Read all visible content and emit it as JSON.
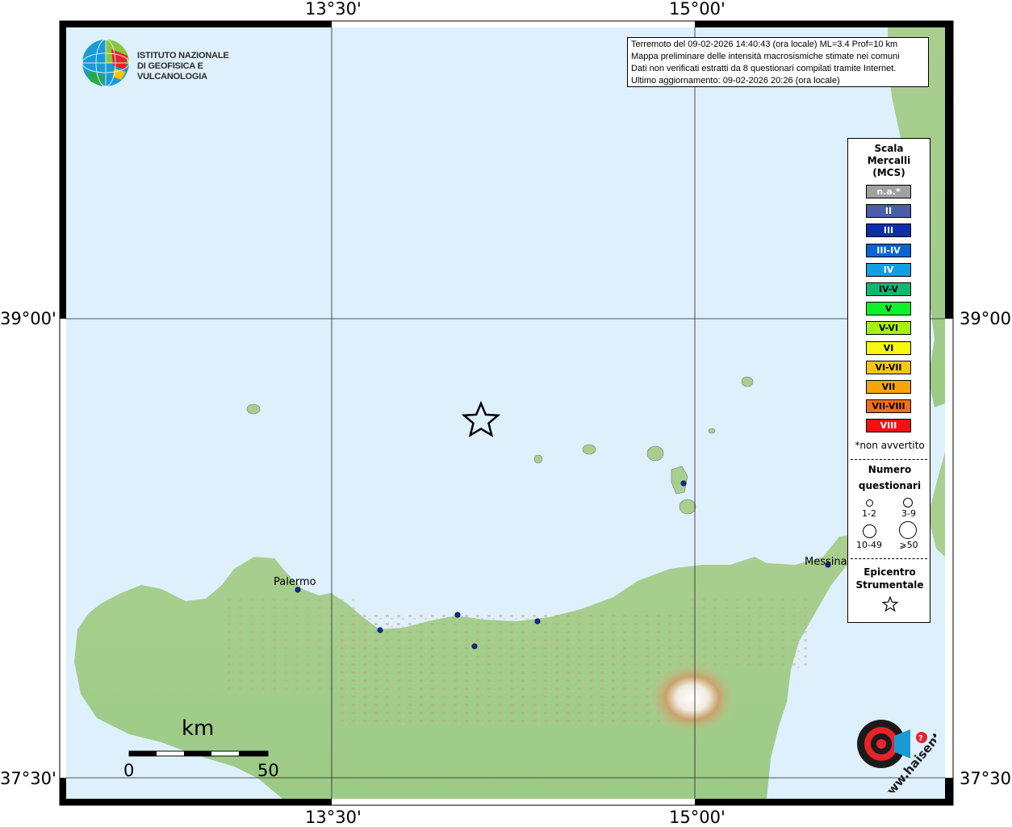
{
  "map": {
    "lon_labels": [
      "13°30'",
      "15°00'"
    ],
    "lat_labels": [
      "39°00'",
      "37°30'"
    ]
  },
  "logo": {
    "line1": "ISTITUTO NAZIONALE",
    "line2": "DI GEOFISICA E VULCANOLOGIA"
  },
  "info": {
    "line1": "Terremoto del 09-02-2026 14:40:43 (ora locale) ML=3.4 Prof=10 km",
    "line2": "Mappa preliminare delle intensità macrosismiche stimate nei comuni",
    "line3": "Dati non verificati estratti da 8 questionari compilati tramite Internet.",
    "line4": "Ultimo aggiornamento: 09-02-2026 20:26 (ora locale)"
  },
  "legend": {
    "title1": "Scala",
    "title2": "Mercalli",
    "title3": "(MCS)",
    "items": [
      {
        "label": "n.a.*",
        "color": "#a0a0a0",
        "text": "#ffffff"
      },
      {
        "label": "II",
        "color": "#4a5fa8",
        "text": "#ffffff"
      },
      {
        "label": "III",
        "color": "#0a2fa8",
        "text": "#ffffff"
      },
      {
        "label": "III-IV",
        "color": "#0a64d2",
        "text": "#ffffff"
      },
      {
        "label": "IV",
        "color": "#11a0e6",
        "text": "#ffffff"
      },
      {
        "label": "IV-V",
        "color": "#10b872",
        "text": "#000000"
      },
      {
        "label": "V",
        "color": "#0ef12a",
        "text": "#000000"
      },
      {
        "label": "V-VI",
        "color": "#a6f012",
        "text": "#000000"
      },
      {
        "label": "VI",
        "color": "#f8f80c",
        "text": "#000000"
      },
      {
        "label": "VI-VII",
        "color": "#f7c612",
        "text": "#000000"
      },
      {
        "label": "VII",
        "color": "#f8a50c",
        "text": "#000000"
      },
      {
        "label": "VII-VIII",
        "color": "#f66e11",
        "text": "#000000"
      },
      {
        "label": "VIII",
        "color": "#f21010",
        "text": "#ffffff"
      }
    ],
    "na_note": "*non avvertito",
    "num_title1": "Numero",
    "num_title2": "questionari",
    "sizes": [
      "1-2",
      "3-9",
      "10-49",
      "⩾50"
    ],
    "epi_title1": "Epicentro",
    "epi_title2": "Strumentale"
  },
  "places": {
    "palermo": "Palermo",
    "messina": "Messina"
  },
  "scalebar": {
    "unit": "km",
    "start": "0",
    "end": "50"
  },
  "haisentito": {
    "text": "www.haisentitoilterremoto.it"
  }
}
